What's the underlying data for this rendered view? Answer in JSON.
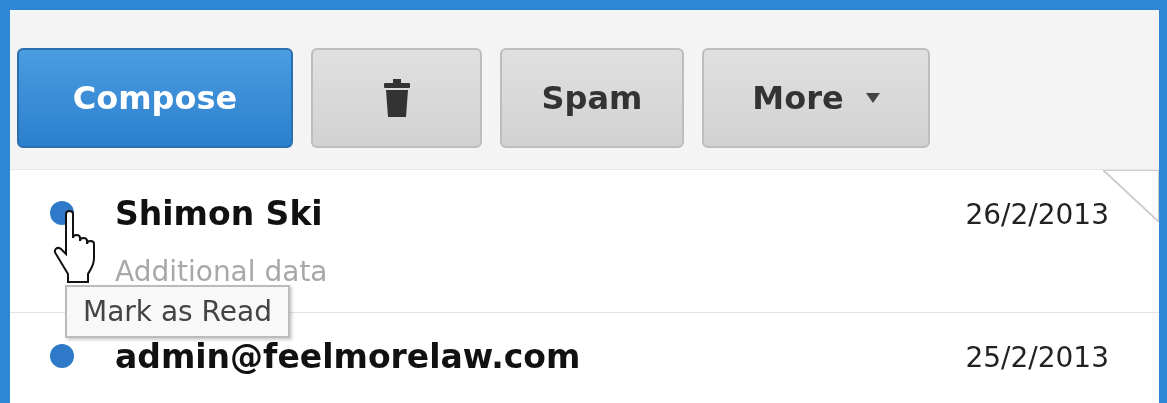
{
  "toolbar": {
    "buttons": [
      {
        "kind": "primary",
        "label": "Compose"
      },
      {
        "kind": "icon"
      },
      {
        "kind": "text",
        "label": "Spam"
      },
      {
        "kind": "dropdown",
        "label": "More"
      }
    ]
  },
  "messages": [
    {
      "sender": "Shimon Ski",
      "date": "26/2/2013",
      "preview": "Additional data",
      "unread": true,
      "folded_corner": true
    },
    {
      "sender": "admin@feelmorelaw.com",
      "date": "25/2/2013",
      "unread": true
    }
  ],
  "tooltip": {
    "text": "Mark as Read"
  }
}
